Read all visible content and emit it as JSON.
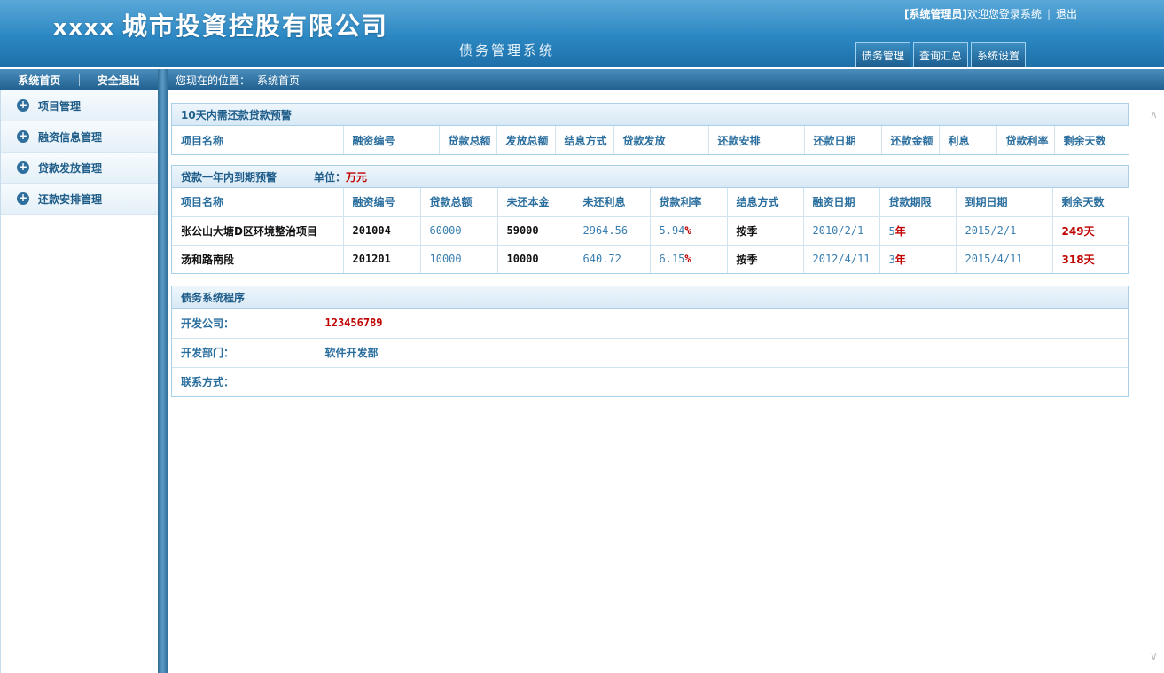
{
  "header": {
    "brand_en": "xxxx",
    "brand_cn": "城市投資控股有限公司",
    "subtitle": "债务管理系统",
    "role": "[系统管理员]",
    "welcome": "欢迎您登录系统",
    "sep": "|",
    "logout": "退出",
    "tabs": [
      "债务管理",
      "查询汇总",
      "系统设置"
    ]
  },
  "toolbar": {
    "home": "系统首页",
    "exit": "安全退出",
    "location_label": "您现在的位置：",
    "location_value": "系统首页"
  },
  "sidebar": {
    "items": [
      {
        "label": "项目管理",
        "icon": "plus-circle-icon"
      },
      {
        "label": "融资信息管理",
        "icon": "plus-circle-icon"
      },
      {
        "label": "贷款发放管理",
        "icon": "plus-circle-icon"
      },
      {
        "label": "还款安排管理",
        "icon": "plus-circle-icon"
      }
    ]
  },
  "panel1": {
    "title": "10天内需还款贷款预警",
    "headers": [
      "项目名称",
      "融资编号",
      "贷款总额",
      "发放总额",
      "结息方式",
      "贷款发放",
      "还款安排",
      "还款日期",
      "还款金额",
      "利息",
      "贷款利率",
      "剩余天数"
    ]
  },
  "panel2": {
    "title": "贷款一年内到期预警",
    "unit_label": "单位：",
    "unit_value": "万元",
    "headers": [
      "项目名称",
      "融资编号",
      "贷款总额",
      "未还本金",
      "未还利息",
      "贷款利率",
      "结息方式",
      "融资日期",
      "贷款期限",
      "到期日期",
      "剩余天数"
    ],
    "rows": [
      {
        "name": "张公山大塘D区环境整治项目",
        "code": "201004",
        "total": "60000",
        "principal": "59000",
        "interest": "2964.56",
        "rate": "5.94",
        "rate_unit": "%",
        "method": "按季",
        "date": "2010/2/1",
        "term": "5",
        "term_unit": "年",
        "due": "2015/2/1",
        "days": "249",
        "days_unit": "天"
      },
      {
        "name": "汤和路南段",
        "code": "201201",
        "total": "10000",
        "principal": "10000",
        "interest": "640.72",
        "rate": "6.15",
        "rate_unit": "%",
        "method": "按季",
        "date": "2012/4/11",
        "term": "3",
        "term_unit": "年",
        "due": "2015/4/11",
        "days": "318",
        "days_unit": "天"
      }
    ]
  },
  "panel3": {
    "title": "债务系统程序",
    "rows": [
      {
        "key": "开发公司：",
        "value": "123456789"
      },
      {
        "key": "开发部门：",
        "value": "软件开发部"
      },
      {
        "key": "联系方式：",
        "value": ""
      }
    ]
  },
  "colors": {
    "accent": "#2b87c2",
    "label_blue": "#2a6e9e",
    "alert_red": "#c00000"
  }
}
